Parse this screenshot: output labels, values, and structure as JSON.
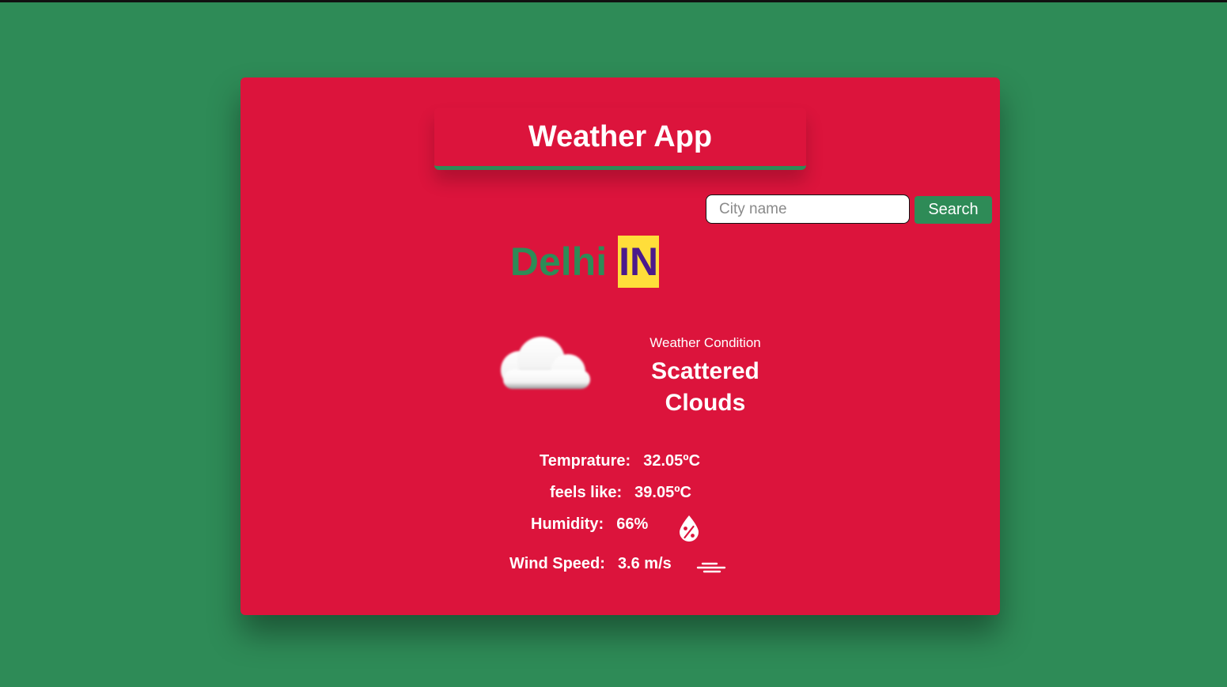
{
  "app": {
    "title": "Weather App"
  },
  "search": {
    "placeholder": "City name",
    "button_label": "Search"
  },
  "location": {
    "city": "Delhi",
    "country": "IN"
  },
  "condition": {
    "label": "Weather Condition",
    "value_line1": "Scattered",
    "value_line2": "Clouds",
    "icon": "cloud-icon"
  },
  "stats": {
    "temperature": {
      "label": "Temprature:",
      "value": "32.05ºC"
    },
    "feels_like": {
      "label": "feels like:",
      "value": "39.05ºC"
    },
    "humidity": {
      "label": "Humidity:",
      "value": "66%",
      "icon": "humidity-drop-icon"
    },
    "wind": {
      "label": "Wind Speed:",
      "value": "3.6 m/s",
      "icon": "wind-icon"
    }
  },
  "colors": {
    "background": "#2e8b57",
    "card": "#dc143c",
    "city": "#2e8b57",
    "country_bg": "#ffde3a",
    "country_text": "#4b1a8c"
  }
}
